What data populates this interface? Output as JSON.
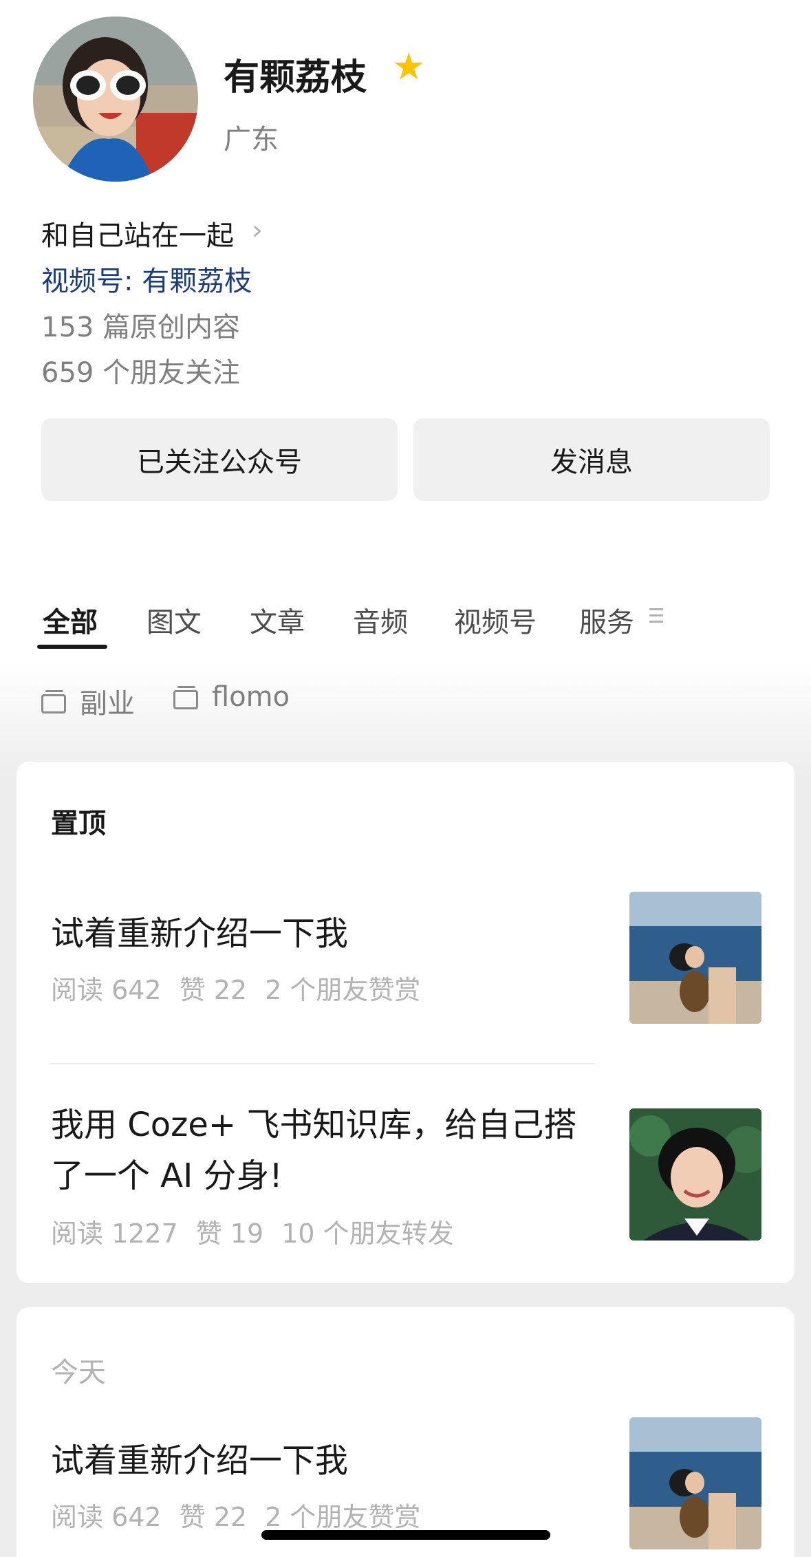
{
  "profile": {
    "name": "有颗荔枝",
    "region": "广东",
    "bio": "和自己站在一起",
    "channel": "视频号: 有颗荔枝",
    "original_count": "153 篇原创内容",
    "friends_following": "659 个朋友关注",
    "follow_button": "已关注公众号",
    "message_button": "发消息"
  },
  "tabs": [
    "全部",
    "图文",
    "文章",
    "音频",
    "视频号",
    "服务"
  ],
  "folders": [
    "副业",
    "flomo"
  ],
  "pinned": {
    "title": "置顶",
    "articles": [
      {
        "title": "试着重新介绍一下我",
        "read": "阅读 642",
        "likes": "赞 22",
        "social": "2 个朋友赞赏"
      },
      {
        "title_line1": "我用 Coze+ 飞书知识库，给自己搭",
        "title_line2": "了一个 AI 分身!",
        "read": "阅读 1227",
        "likes": "赞 19",
        "social": "10 个朋友转发"
      }
    ]
  },
  "today": {
    "title": "今天",
    "articles": [
      {
        "title": "试着重新介绍一下我",
        "read": "阅读 642",
        "likes": "赞 22",
        "social": "2 个朋友赞赏"
      }
    ]
  },
  "colors": {
    "star": "#ffc300",
    "channel_link": "#1c3d7a",
    "secondary_text": "#7f7f7f",
    "meta_text": "#b2b2b2"
  }
}
